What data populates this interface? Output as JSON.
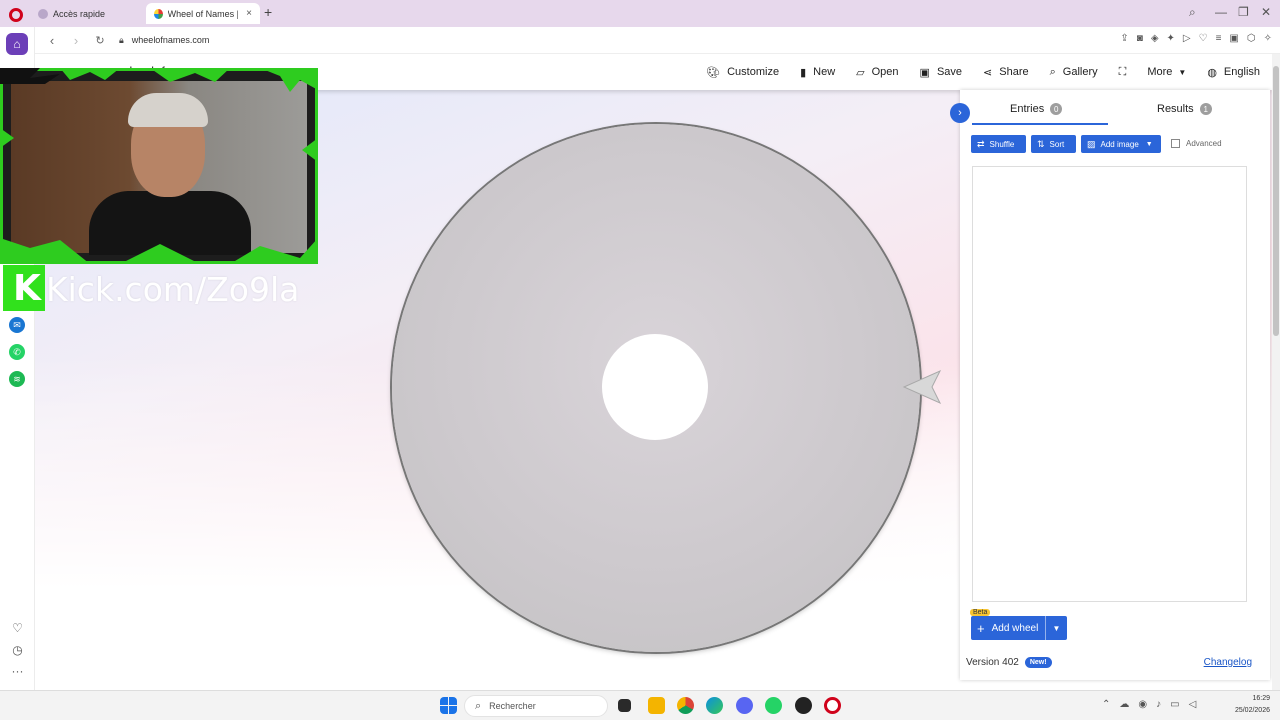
{
  "browser": {
    "tabs": [
      {
        "label": "Accès rapide",
        "active": false
      },
      {
        "label": "Wheel of Names | Randon",
        "active": true
      }
    ],
    "url": "wheelofnames.com"
  },
  "site": {
    "title": "wheelofnames.com",
    "menu": [
      {
        "label": "Customize",
        "icon": "palette-icon"
      },
      {
        "label": "New",
        "icon": "file-icon"
      },
      {
        "label": "Open",
        "icon": "folder-open-icon"
      },
      {
        "label": "Save",
        "icon": "floppy-icon"
      },
      {
        "label": "Share",
        "icon": "share-icon"
      },
      {
        "label": "Gallery",
        "icon": "search-icon"
      },
      {
        "label": "",
        "icon": "fullscreen-icon"
      },
      {
        "label": "More",
        "icon": "caret-down-icon"
      },
      {
        "label": "English",
        "icon": "globe-icon"
      }
    ]
  },
  "panel": {
    "entries_tab": {
      "label": "Entries",
      "count": "0"
    },
    "results_tab": {
      "label": "Results",
      "count": "1"
    },
    "buttons": {
      "shuffle": "Shuffle",
      "sort": "Sort",
      "add_image": "Add image",
      "advanced": "Advanced"
    },
    "add_wheel": {
      "label": "Add wheel",
      "beta": "Beta"
    },
    "version": "Version 402",
    "new_badge": "New!",
    "changelog": "Changelog"
  },
  "overlay": {
    "kick_text": "Kick.com/Zo9la"
  },
  "taskbar": {
    "search_placeholder": "Rechercher",
    "time": "16:29",
    "date": "25/02/2026"
  },
  "colors": {
    "accent": "#2b65d9",
    "kick_green": "#31e11c",
    "opera_red": "#d0021b"
  }
}
